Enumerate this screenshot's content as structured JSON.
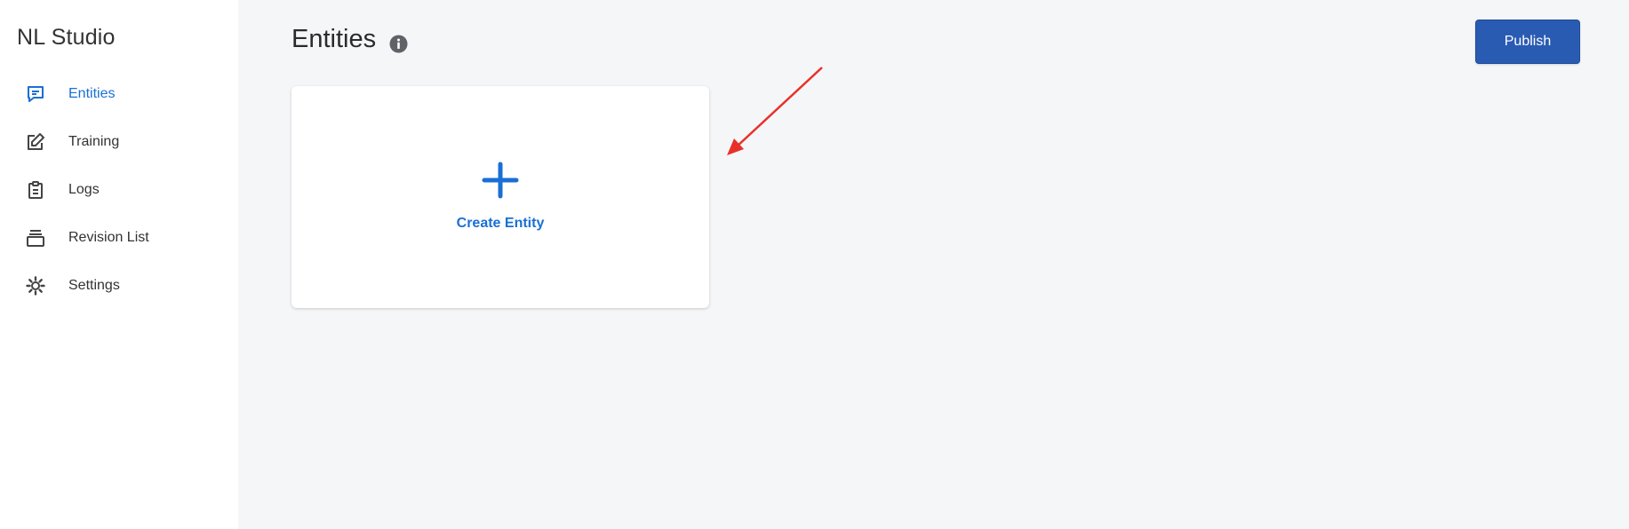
{
  "app": {
    "title": "NL Studio"
  },
  "sidebar": {
    "items": [
      {
        "label": "Entities",
        "icon": "message-square-icon",
        "active": true
      },
      {
        "label": "Training",
        "icon": "edit-icon",
        "active": false
      },
      {
        "label": "Logs",
        "icon": "clipboard-icon",
        "active": false
      },
      {
        "label": "Revision List",
        "icon": "stack-icon",
        "active": false
      },
      {
        "label": "Settings",
        "icon": "gear-icon",
        "active": false
      }
    ]
  },
  "header": {
    "title": "Entities",
    "info_icon": "info-icon",
    "publish_label": "Publish"
  },
  "main": {
    "create_card": {
      "label": "Create Entity",
      "icon": "plus-icon"
    }
  },
  "colors": {
    "accent": "#1a6fd4",
    "publish_bg": "#2a5bb3",
    "annotation_arrow": "#e8302a",
    "sidebar_bg": "#ffffff",
    "main_bg": "#f5f6f8"
  }
}
